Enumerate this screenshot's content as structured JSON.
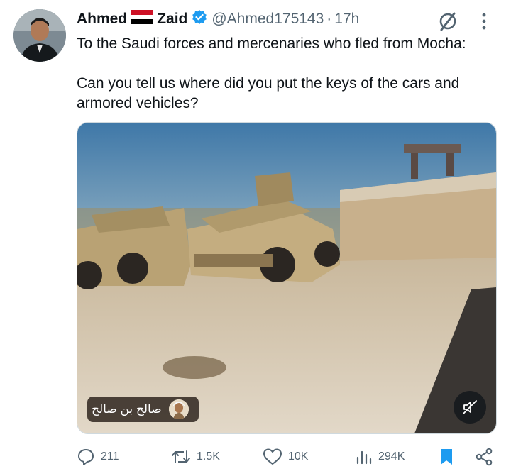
{
  "author": {
    "name_first": "Ahmed",
    "name_last": "Zaid",
    "handle": "@Ahmed175143",
    "separator": "·",
    "time": "17h"
  },
  "tweet": {
    "line1": "To the Saudi forces and mercenaries who fled from Mocha:",
    "line2": "Can you tell us where did you put the keys of the cars and armored vehicles?"
  },
  "media": {
    "watermark_text": "صالح بن صالح"
  },
  "actions": {
    "replies": "211",
    "reposts": "1.5K",
    "likes": "10K",
    "views": "294K"
  },
  "colors": {
    "text": "#0f1419",
    "secondary": "#536471",
    "verified": "#1d9bf0",
    "bookmark": "#1d9bf0"
  },
  "icons": [
    "flag-yemen-icon",
    "verified-badge-icon",
    "grok-icon",
    "more-icon",
    "mute-icon",
    "reply-icon",
    "repost-icon",
    "like-icon",
    "views-icon",
    "bookmark-icon",
    "share-icon"
  ]
}
